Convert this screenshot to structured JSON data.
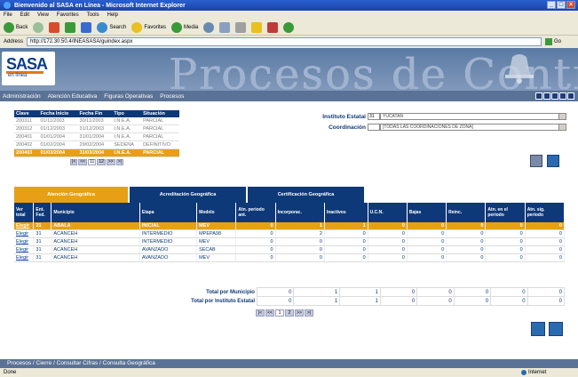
{
  "window": {
    "title": "Bienvenido al SASA en Línea - Microsoft Internet Explorer"
  },
  "menu": [
    "File",
    "Edit",
    "View",
    "Favorites",
    "Tools",
    "Help"
  ],
  "toolbar": {
    "back": "Back",
    "search": "Search",
    "favorites": "Favorites",
    "media": "Media"
  },
  "address": {
    "label": "Address",
    "url": "http://172.30.50.4/INEASASA/guindex.aspx",
    "go": "Go"
  },
  "banner": {
    "logo": "SASA",
    "logo_sub": "en línea",
    "title": "Procesos de Control"
  },
  "nav": [
    "Administración",
    "Atención Educativa",
    "Figuras Operativas",
    "Procesos"
  ],
  "periods": {
    "headers": [
      "Clave",
      "Fecha Inicio",
      "Fecha Fin",
      "Tipo",
      "Situación"
    ],
    "rows": [
      [
        "200311",
        "01/11/2003",
        "30/11/2003",
        "I.N.E.A.",
        "PARCIAL"
      ],
      [
        "200312",
        "01/12/2003",
        "31/12/2003",
        "I.N.E.A.",
        "PARCIAL"
      ],
      [
        "200401",
        "01/01/2004",
        "31/01/2004",
        "I.N.E.A.",
        "PARCIAL"
      ],
      [
        "200402",
        "01/02/2004",
        "29/02/2004",
        "SEDENA",
        "DEFINITIVO"
      ],
      [
        "200403",
        "01/03/2004",
        "31/03/2004",
        "I.N.E.A.",
        "PARCIAL"
      ]
    ],
    "pager": [
      "|<",
      "<<",
      "11",
      "12",
      ">>",
      ">|"
    ]
  },
  "filters": {
    "instituto_label": "Instituto Estatal",
    "instituto_code": "31",
    "instituto_value": "YUCATAN",
    "coord_label": "Coordinación",
    "coord_value": "[TODAS LAS COORDINACIONES DE ZONA]"
  },
  "tabs": [
    {
      "label": "Atención Geográfica"
    },
    {
      "label": "Acreditación Geográfica"
    },
    {
      "label": "Certificación Geográfica"
    }
  ],
  "grid": {
    "headers": [
      "Ver total",
      "Ent. Fed.",
      "Municipio",
      "Etapa",
      "Modelo",
      "Atn. periodo ant.",
      "Incorporac.",
      "Inactivos",
      "U.C.N.",
      "Bajas",
      "Reinc.",
      "Atn. en el periodo",
      "Atn. sig. periodo"
    ],
    "rows": [
      [
        "Elegir",
        "31",
        "ABALA",
        "INICIAL",
        "MEV",
        "0",
        "1",
        "1",
        "0",
        "0",
        "0",
        "0",
        "0"
      ],
      [
        "Elegir",
        "31",
        "ACANCEH",
        "INTERMEDIO",
        "MPEPA98",
        "0",
        "2",
        "0",
        "0",
        "0",
        "0",
        "0",
        "0"
      ],
      [
        "Elegir",
        "31",
        "ACANCEH",
        "INTERMEDIO",
        "MEV",
        "0",
        "0",
        "0",
        "0",
        "0",
        "0",
        "0",
        "0"
      ],
      [
        "Elegir",
        "31",
        "ACANCEH",
        "AVANZADO",
        "SECAB",
        "0",
        "0",
        "0",
        "0",
        "0",
        "0",
        "0",
        "0"
      ],
      [
        "Elegir",
        "31",
        "ACANCEH",
        "AVANZADO",
        "MEV",
        "0",
        "0",
        "0",
        "0",
        "0",
        "0",
        "0",
        "0"
      ]
    ]
  },
  "totals": {
    "municipio_label": "Total por Municipio",
    "municipio": [
      "0",
      "1",
      "1",
      "0",
      "0",
      "0",
      "0",
      "0"
    ],
    "instituto_label": "Total por Instituto Estatal",
    "instituto": [
      "0",
      "1",
      "1",
      "0",
      "0",
      "0",
      "0",
      "0"
    ]
  },
  "grid_pager": [
    "|<",
    "<<",
    "1",
    "2",
    ">>",
    ">|"
  ],
  "footer": "Procesos / Cierre / Consultar Cifras / Consulta Geográfica",
  "status": {
    "left": "Done",
    "zone": "Internet"
  }
}
